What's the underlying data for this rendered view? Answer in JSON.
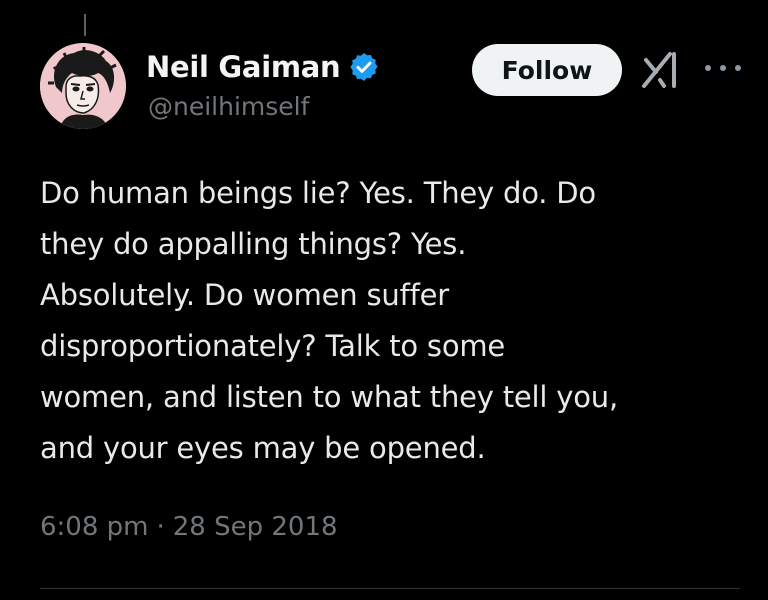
{
  "author": {
    "display_name": "Neil Gaiman",
    "handle": "@neilhimself",
    "verified": true,
    "avatar_icon": "cartoon-portrait-avatar",
    "avatar_bg": "#f0c8cc"
  },
  "actions": {
    "follow_label": "Follow",
    "grok_icon": "grok-icon",
    "more_icon": "more-options-icon"
  },
  "tweet": {
    "text": "Do human beings lie? Yes. They do. Do\nthey do appalling things? Yes.\nAbsolutely. Do women suffer\ndisproportionately? Talk to some\nwomen, and listen to what they tell you,\nand your eyes may be opened.",
    "time": "6:08 pm",
    "separator": "·",
    "date": "28 Sep 2018"
  },
  "colors": {
    "background": "#000000",
    "text": "#e7e9ea",
    "secondary": "#71767b",
    "verified_blue": "#1d9bf0",
    "follow_bg": "#eff3f4"
  }
}
